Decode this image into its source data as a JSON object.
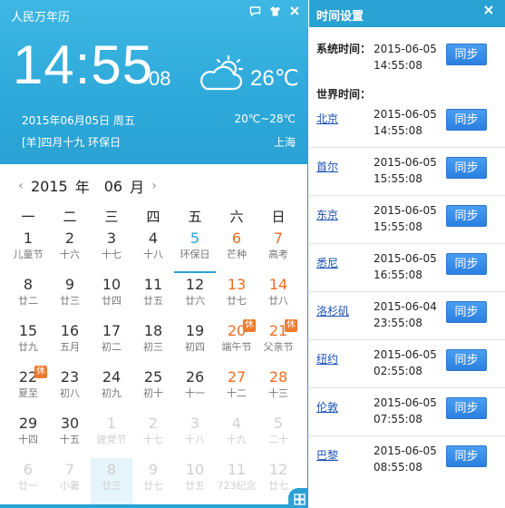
{
  "app": {
    "title": "人民万年历",
    "icons": [
      "chat-icon",
      "shirt-icon",
      "close-icon"
    ]
  },
  "clock": {
    "time": "14:55",
    "seconds": "08"
  },
  "weather": {
    "icon": "partly-cloudy-icon",
    "temp": "26℃",
    "range": "20℃~28℃",
    "city": "上海"
  },
  "date": {
    "text": "2015年06月05日  周五",
    "lunar": "[羊]四月十九  环保日"
  },
  "calendar": {
    "year": "2015",
    "year_unit": "年",
    "month": "06",
    "month_unit": "月",
    "weekdays": [
      "一",
      "二",
      "三",
      "四",
      "五",
      "六",
      "日"
    ],
    "cells": [
      {
        "d": "1",
        "l": "儿童节"
      },
      {
        "d": "2",
        "l": "十六"
      },
      {
        "d": "3",
        "l": "十七"
      },
      {
        "d": "4",
        "l": "十八"
      },
      {
        "d": "5",
        "l": "环保日",
        "today": true
      },
      {
        "d": "6",
        "l": "芒种",
        "we": true
      },
      {
        "d": "7",
        "l": "高考",
        "we": true
      },
      {
        "d": "8",
        "l": "廿二"
      },
      {
        "d": "9",
        "l": "廿三"
      },
      {
        "d": "10",
        "l": "廿四"
      },
      {
        "d": "11",
        "l": "廿五"
      },
      {
        "d": "12",
        "l": "廿六"
      },
      {
        "d": "13",
        "l": "廿七",
        "we": true
      },
      {
        "d": "14",
        "l": "廿八",
        "we": true
      },
      {
        "d": "15",
        "l": "廿九"
      },
      {
        "d": "16",
        "l": "五月"
      },
      {
        "d": "17",
        "l": "初二"
      },
      {
        "d": "18",
        "l": "初三"
      },
      {
        "d": "19",
        "l": "初四"
      },
      {
        "d": "20",
        "l": "端午节",
        "we": true,
        "rest": "休"
      },
      {
        "d": "21",
        "l": "父亲节",
        "we": true,
        "rest": "休"
      },
      {
        "d": "22",
        "l": "夏至",
        "rest": "休"
      },
      {
        "d": "23",
        "l": "初八"
      },
      {
        "d": "24",
        "l": "初九"
      },
      {
        "d": "25",
        "l": "初十"
      },
      {
        "d": "26",
        "l": "十一"
      },
      {
        "d": "27",
        "l": "十二",
        "we": true
      },
      {
        "d": "28",
        "l": "十三",
        "we": true
      },
      {
        "d": "29",
        "l": "十四"
      },
      {
        "d": "30",
        "l": "十五"
      },
      {
        "d": "1",
        "l": "建党节",
        "other": true
      },
      {
        "d": "2",
        "l": "十七",
        "other": true
      },
      {
        "d": "3",
        "l": "十八",
        "other": true
      },
      {
        "d": "4",
        "l": "十九",
        "other": true
      },
      {
        "d": "5",
        "l": "二十",
        "other": true
      },
      {
        "d": "6",
        "l": "廿一",
        "other": true
      },
      {
        "d": "7",
        "l": "小暑",
        "other": true
      },
      {
        "d": "8",
        "l": "廿三",
        "other": true,
        "sel": true
      },
      {
        "d": "9",
        "l": "廿七",
        "other": true
      },
      {
        "d": "10",
        "l": "廿五",
        "other": true
      },
      {
        "d": "11",
        "l": "723纪念",
        "other": true
      },
      {
        "d": "12",
        "l": "廿七",
        "other": true
      }
    ]
  },
  "panel": {
    "title": "时间设置",
    "sys_label": "系统时间：",
    "world_label": "世界时间：",
    "sync_label": "同步",
    "system": {
      "date": "2015-06-05",
      "time": "14:55:08"
    },
    "cities": [
      {
        "name": "北京",
        "date": "2015-06-05",
        "time": "14:55:08"
      },
      {
        "name": "首尔",
        "date": "2015-06-05",
        "time": "15:55:08"
      },
      {
        "name": "东京",
        "date": "2015-06-05",
        "time": "15:55:08"
      },
      {
        "name": "悉尼",
        "date": "2015-06-05",
        "time": "16:55:08"
      },
      {
        "name": "洛杉矶",
        "date": "2015-06-04",
        "time": "23:55:08"
      },
      {
        "name": "纽约",
        "date": "2015-06-05",
        "time": "02:55:08"
      },
      {
        "name": "伦敦",
        "date": "2015-06-05",
        "time": "07:55:08"
      },
      {
        "name": "巴黎",
        "date": "2015-06-05",
        "time": "08:55:08"
      }
    ]
  }
}
